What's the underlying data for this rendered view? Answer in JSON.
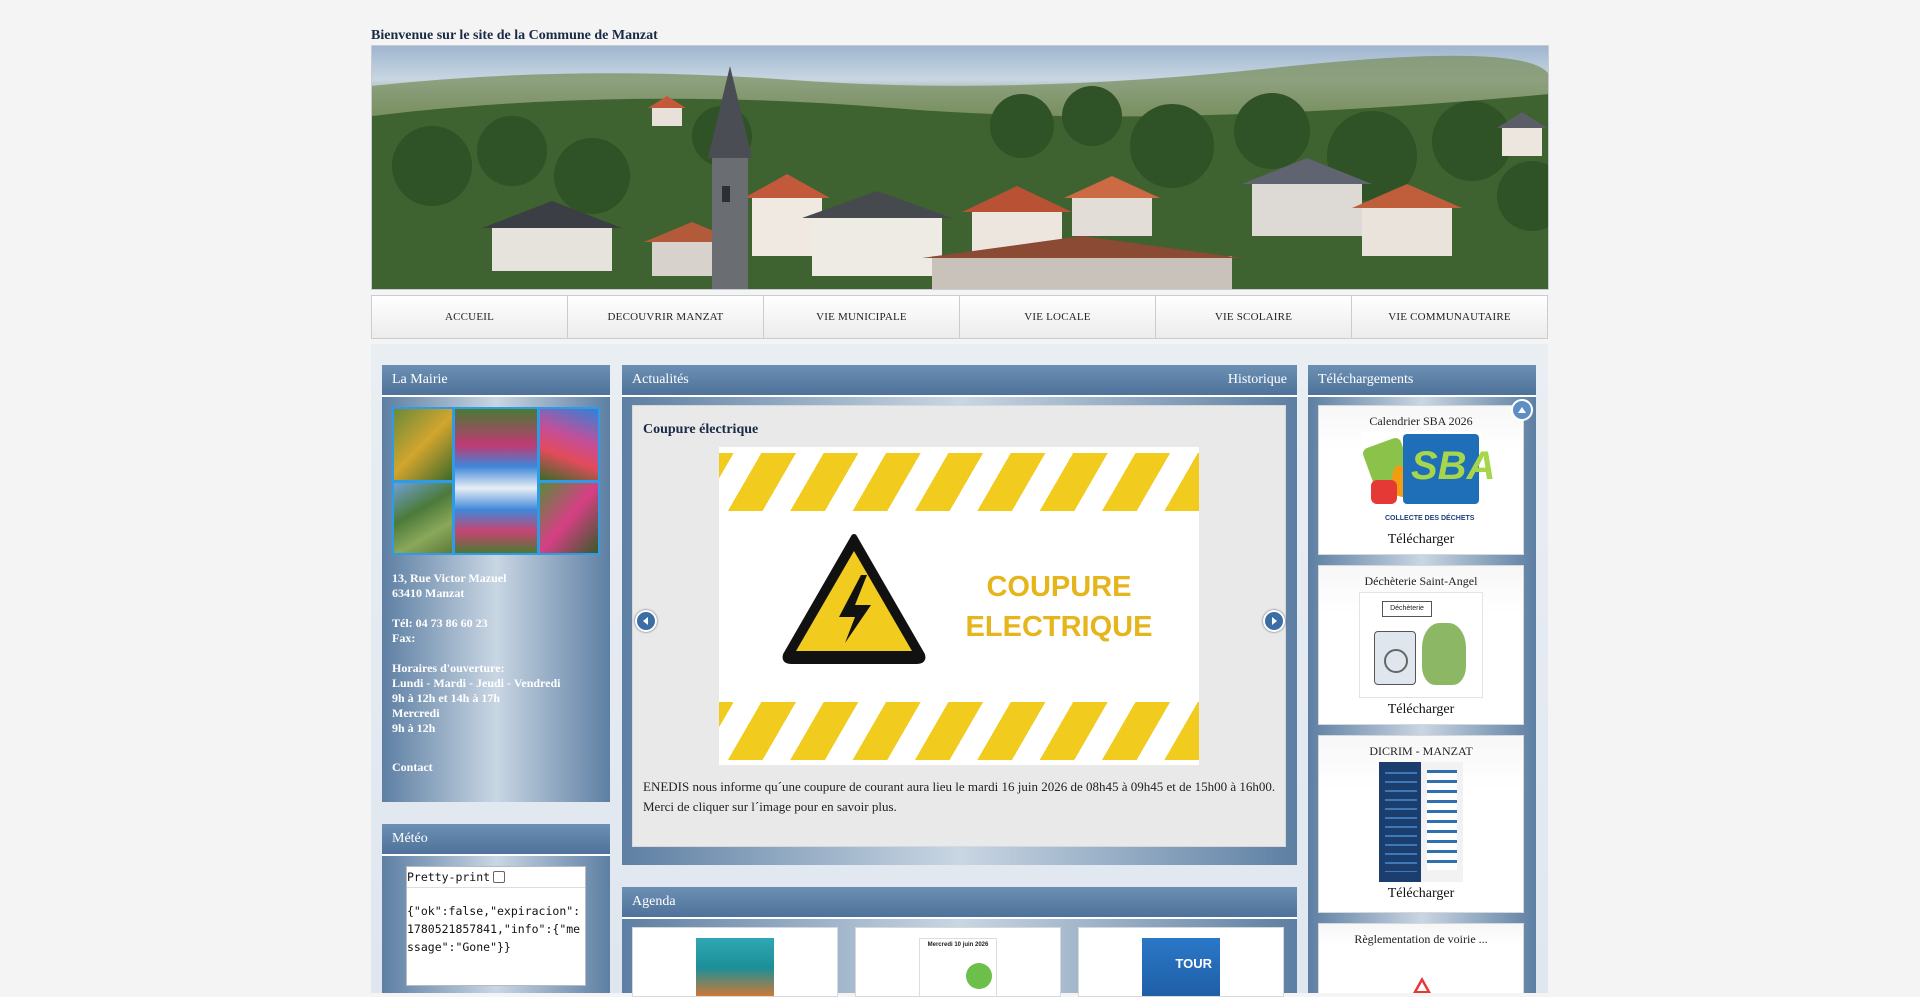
{
  "site": {
    "title": "Bienvenue sur le site de la Commune de Manzat"
  },
  "nav": {
    "items": [
      {
        "label": "ACCUEIL"
      },
      {
        "label": "DECOUVRIR MANZAT"
      },
      {
        "label": "VIE MUNICIPALE"
      },
      {
        "label": "VIE LOCALE"
      },
      {
        "label": "VIE SCOLAIRE"
      },
      {
        "label": "VIE COMMUNAUTAIRE"
      }
    ]
  },
  "mairie": {
    "header": "La Mairie",
    "address_line1": "13, Rue Victor Mazuel",
    "address_line2": "63410 Manzat",
    "tel": "Tél: 04 73 86 60 23",
    "fax": "Fax:",
    "hours_title": "Horaires d'ouverture:",
    "hours_days": "Lundi - Mardi - Jeudi - Vendredi",
    "hours_times": "9h à 12h et 14h à 17h",
    "wednesday": "Mercredi",
    "wednesday_hours": "9h à 12h",
    "contact_label": "Contact"
  },
  "meteo": {
    "header": "Météo",
    "pretty_label": "Pretty-print",
    "json_text": "{\"ok\":false,\"expiracion\":1780521857841,\"info\":{\"message\":\"Gone\"}}"
  },
  "actualites": {
    "header": "Actualités",
    "historique": "Historique",
    "article": {
      "title": "Coupure électrique",
      "image_text_line1": "COUPURE",
      "image_text_line2": "ELECTRIQUE",
      "body": "ENEDIS nous informe qu´une coupure de courant aura lieu le mardi 16 juin 2026 de 08h45 à 09h45 et de 15h00 à 16h00. Merci de cliquer sur l´image pour en savoir plus."
    }
  },
  "agenda": {
    "header": "Agenda",
    "item2_text": "Mercredi 10 juin 2026",
    "item3_text": "TOUR"
  },
  "telechargements": {
    "header": "Téléchargements",
    "items": [
      {
        "title": "Calendrier SBA 2026",
        "link": "Télécharger",
        "logo_text": "SBA",
        "logo_subtitle": "COLLECTE DES DÉCHETS"
      },
      {
        "title": "Déchèterie Saint-Angel",
        "link": "Télécharger",
        "logo_text": "Déchèterie"
      },
      {
        "title": "DICRIM - MANZAT",
        "link": "Télécharger"
      },
      {
        "title": "Règlementation de voirie ..."
      }
    ]
  },
  "colors": {
    "panel_header": "#4f729a",
    "accent_blue": "#2e9be6",
    "warning_yellow": "#f1cb1e"
  }
}
